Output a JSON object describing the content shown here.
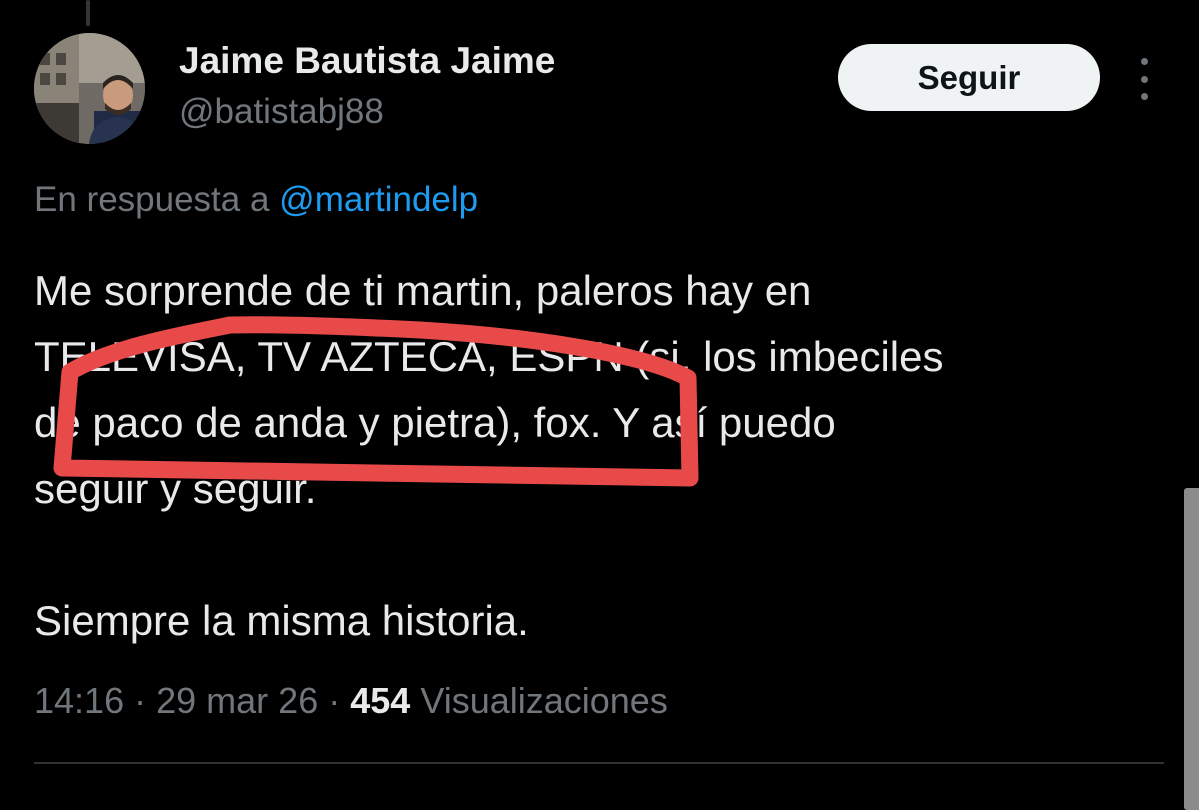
{
  "author": {
    "display_name": "Jaime Bautista Jaime",
    "handle": "@batistabj88"
  },
  "actions": {
    "follow_label": "Seguir",
    "more_icon": "more-vertical-icon"
  },
  "reply": {
    "prefix": "En respuesta a",
    "mention": "@martindelp"
  },
  "tweet": {
    "lines": [
      "Me sorprende de ti martin, paleros hay en",
      "TELEVISA, TV AZTECA, ESPN (si, los imbeciles",
      "de paco de anda y pietra), fox. Y así puedo",
      "seguir y seguir."
    ],
    "closing": "Siempre la misma historia."
  },
  "meta": {
    "time": "14:16",
    "date": "29 mar 26",
    "separator": "·",
    "views_count": "454",
    "views_label": "Visualizaciones"
  },
  "colors": {
    "background": "#000000",
    "text": "#e7e9ea",
    "secondary": "#71767b",
    "link": "#1d9bf0",
    "annotation": "#e84a4a"
  }
}
